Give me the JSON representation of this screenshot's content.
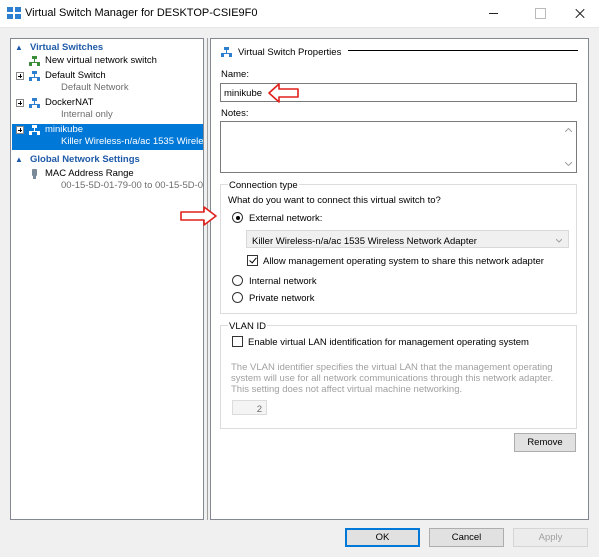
{
  "window": {
    "title": "Virtual Switch Manager for DESKTOP-CSIE9F0",
    "controls": {
      "minimize": "—",
      "maximize": "□",
      "close": "✕"
    }
  },
  "tree": {
    "virtual_switches_header": "Virtual Switches",
    "new_switch": "New virtual network switch",
    "switches": [
      {
        "name": "Default Switch",
        "detail": "Default Network"
      },
      {
        "name": "DockerNAT",
        "detail": "Internal only"
      },
      {
        "name": "minikube",
        "detail": "Killer Wireless-n/a/ac 1535 Wireles..."
      }
    ],
    "global_header": "Global Network Settings",
    "mac": {
      "name": "MAC Address Range",
      "detail": "00-15-5D-01-79-00 to 00-15-5D-0..."
    }
  },
  "props": {
    "section_title": "Virtual Switch Properties",
    "name_label": "Name:",
    "name_value": "minikube",
    "notes_label": "Notes:",
    "notes_value": "",
    "conn_type_label": "Connection type",
    "conn_question": "What do you want to connect this virtual switch to?",
    "external_label": "External network:",
    "adapter_value": "Killer Wireless-n/a/ac 1535 Wireless Network Adapter",
    "allow_mgmt_label": "Allow management operating system to share this network adapter",
    "internal_label": "Internal network",
    "private_label": "Private network",
    "vlan_label": "VLAN ID",
    "vlan_enable_label": "Enable virtual LAN identification for management operating system",
    "vlan_desc": "The VLAN identifier specifies the virtual LAN that the management operating system will use for all network communications through this network adapter. This setting does not affect virtual machine networking.",
    "vlan_value": "2",
    "remove_label": "Remove"
  },
  "buttons": {
    "ok": "OK",
    "cancel": "Cancel",
    "apply": "Apply"
  },
  "state": {
    "external_selected": true,
    "allow_mgmt_checked": true,
    "vlan_checked": false,
    "selected_switch": "minikube"
  },
  "colors": {
    "selection": "#0078d7",
    "header_blue": "#1e5aa8",
    "annotation_red": "#e0201b"
  }
}
